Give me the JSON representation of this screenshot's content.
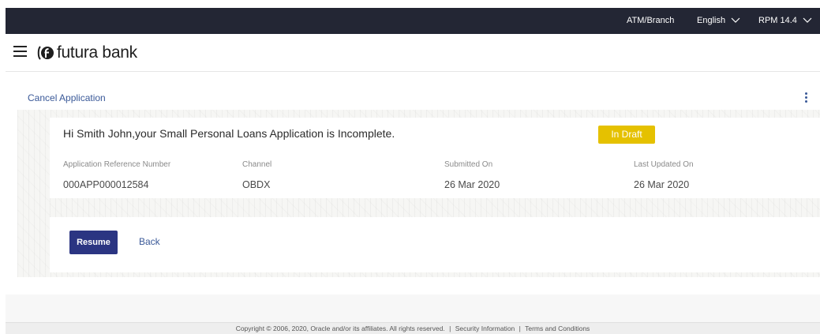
{
  "topbar": {
    "atm_branch": "ATM/Branch",
    "language": "English",
    "version": "RPM 14.4"
  },
  "header": {
    "brand_name": "futura bank"
  },
  "page": {
    "cancel_application": "Cancel Application",
    "greeting": "Hi Smith John,your Small Personal Loans Application is Incomplete.",
    "status_badge": "In Draft",
    "fields": [
      {
        "label": "Application Reference Number",
        "value": "000APP000012584"
      },
      {
        "label": "Channel",
        "value": "OBDX"
      },
      {
        "label": "Submitted On",
        "value": "26 Mar 2020"
      },
      {
        "label": "Last Updated On",
        "value": "26 Mar 2020"
      }
    ],
    "resume_label": "Resume",
    "back_label": "Back"
  },
  "footer": {
    "copyright": "Copyright © 2006, 2020, Oracle and/or its affiliates. All rights reserved.",
    "separator": "|",
    "security_information": "Security Information",
    "terms_and_conditions": "Terms and Conditions"
  },
  "colors": {
    "topbar_bg": "#232634",
    "badge_bg": "#e5c100",
    "primary_button": "#2b3582",
    "link": "#3a5998"
  },
  "icons": [
    "hamburger-menu-icon",
    "futura-bank-logo-icon",
    "chevron-down-icon",
    "kebab-menu-icon"
  ]
}
